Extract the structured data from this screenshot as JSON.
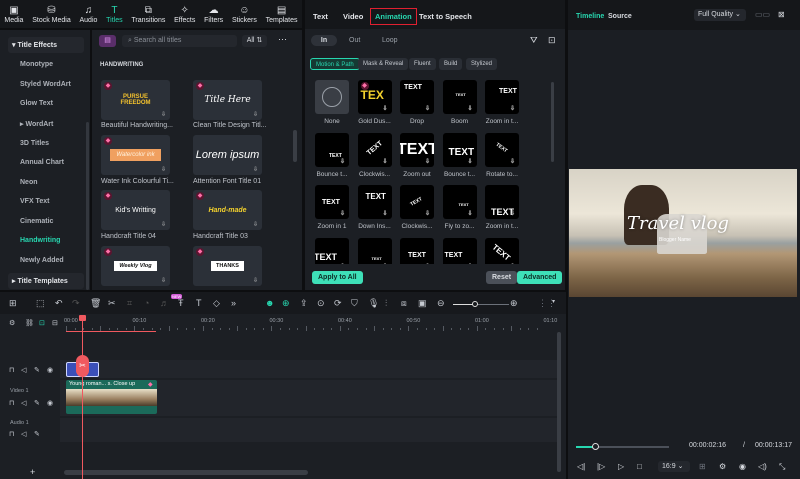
{
  "topnav": [
    {
      "label": "Media",
      "icon": "media-icon",
      "glyph": "▣"
    },
    {
      "label": "Stock Media",
      "icon": "stock-media-icon",
      "glyph": "⛁"
    },
    {
      "label": "Audio",
      "icon": "music-icon",
      "glyph": "♫"
    },
    {
      "label": "Titles",
      "icon": "titles-icon",
      "glyph": "T"
    },
    {
      "label": "Transitions",
      "icon": "transitions-icon",
      "glyph": "⧉"
    },
    {
      "label": "Effects",
      "icon": "effects-icon",
      "glyph": "✧"
    },
    {
      "label": "Filters",
      "icon": "filters-icon",
      "glyph": "☁"
    },
    {
      "label": "Stickers",
      "icon": "stickers-icon",
      "glyph": "☺"
    },
    {
      "label": "Templates",
      "icon": "templates-icon",
      "glyph": "▤"
    }
  ],
  "sidebar": {
    "group1": "Title Effects",
    "items": [
      "Monotype",
      "Styled WordArt",
      "Glow Text",
      "WordArt",
      "3D Titles",
      "Annual Chart",
      "Neon",
      "VFX Text",
      "Cinematic",
      "Handwriting",
      "Newly Added"
    ],
    "group2": "Title Templates"
  },
  "browser": {
    "search_placeholder": "Search all titles",
    "filter": "All",
    "section": "HANDWRITING",
    "items": [
      {
        "name": "Beautiful Handwriting...",
        "preview": "PURSUE FREEDOM"
      },
      {
        "name": "Clean Title Design Titl...",
        "preview": "Title Here"
      },
      {
        "name": "Water Ink Colourful Ti...",
        "preview": "Watercolor ink"
      },
      {
        "name": "Attention Font Title 01",
        "preview": "Lorem ipsum"
      },
      {
        "name": "Handcraft Title 04",
        "preview": "Kid's Writting"
      },
      {
        "name": "Handcraft Title 03",
        "preview": "Hand-made"
      },
      {
        "name": "",
        "preview": "Weekly Vlog"
      },
      {
        "name": "",
        "preview": "THANKS"
      }
    ]
  },
  "props": {
    "tabs": [
      "Text",
      "Video",
      "Animation",
      "Text to Speech"
    ],
    "subtabs": [
      "In",
      "Out",
      "Loop"
    ],
    "chips": [
      "Motion & Path",
      "Mask & Reveal",
      "Fluent",
      "Build",
      "Stylized"
    ],
    "anims": [
      {
        "name": "None",
        "preview": ""
      },
      {
        "name": "Gold Dus...",
        "preview": "TEX"
      },
      {
        "name": "Drop",
        "preview": "TEXT"
      },
      {
        "name": "Boom",
        "preview": "TEXT"
      },
      {
        "name": "Zoom in t...",
        "preview": "TEXT"
      },
      {
        "name": "Bounce t...",
        "preview": "TEXT"
      },
      {
        "name": "Clockwis...",
        "preview": "TEXT"
      },
      {
        "name": "Zoom out",
        "preview": "TEXT"
      },
      {
        "name": "Bounce t...",
        "preview": "TEXT"
      },
      {
        "name": "Rotate to...",
        "preview": "TEXT"
      },
      {
        "name": "Zoom in 1",
        "preview": "TEXT"
      },
      {
        "name": "Down Ins...",
        "preview": "TEXT"
      },
      {
        "name": "Clockwis...",
        "preview": "TEXT"
      },
      {
        "name": "Fly to zo...",
        "preview": "TEXT"
      },
      {
        "name": "Zoom in t...",
        "preview": "TEXT"
      },
      {
        "name": "",
        "preview": "TEXT"
      },
      {
        "name": "",
        "preview": "TEXT"
      },
      {
        "name": "",
        "preview": "TEXT"
      },
      {
        "name": "",
        "preview": "TEXT"
      },
      {
        "name": "",
        "preview": "TEXT"
      }
    ],
    "apply_all": "Apply to All",
    "reset": "Reset",
    "advanced": "Advanced"
  },
  "preview": {
    "tabs": [
      "Timeline",
      "Source"
    ],
    "quality": "Full Quality",
    "title": "Travel vlog",
    "subtitle": "Blogger Name",
    "current_time": "00:00:02:16",
    "separator": "/",
    "total_time": "00:00:13:17",
    "ratio": "16:9",
    "progress": 0.2
  },
  "timeline": {
    "ruler": [
      "00:00",
      "00:10",
      "00:20",
      "00:30",
      "00:40",
      "00:50",
      "01:00",
      "01:10"
    ],
    "clip_title": "Young roman... s. Close up",
    "tracks": [
      "Video 1",
      "Audio 1"
    ],
    "badge_new": "NEW"
  },
  "colors": {
    "accent": "#27d7b0",
    "playhead": "#f0595f"
  }
}
